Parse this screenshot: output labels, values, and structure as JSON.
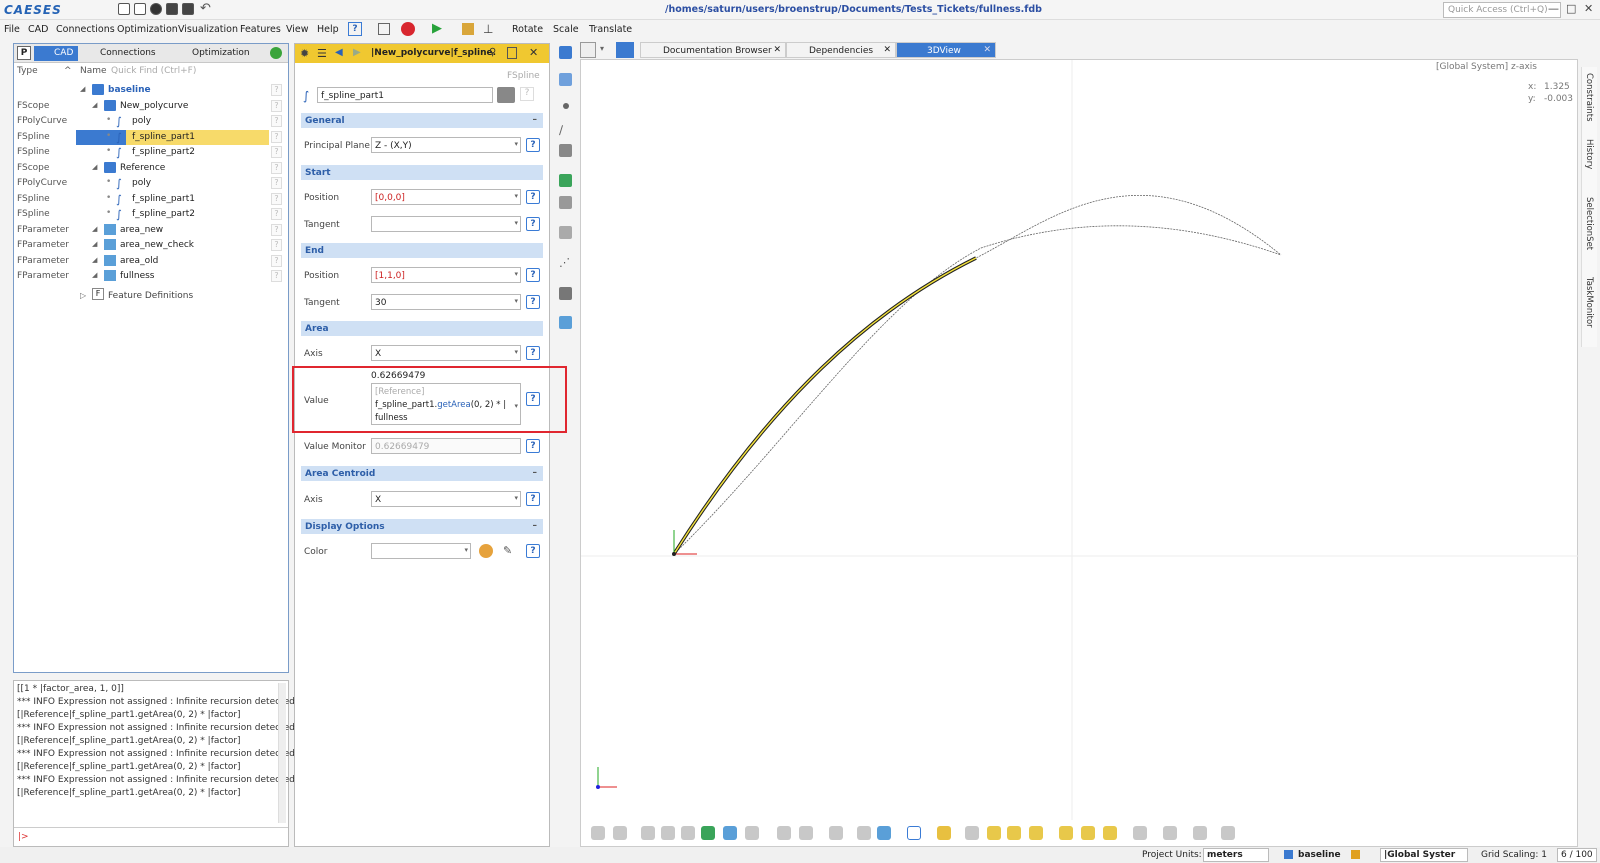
{
  "app": {
    "logo": "CAESES",
    "path": "/homes/saturn/users/broenstrup/Documents/Tests_Tickets/fullness.fdb",
    "quick_access_placeholder": "Quick Access (Ctrl+Q)"
  },
  "menu": [
    "File",
    "CAD",
    "Connections",
    "Optimization",
    "Visualization",
    "Features",
    "View",
    "Help"
  ],
  "menu_actions": {
    "rotate": "Rotate",
    "scale": "Scale",
    "translate": "Translate"
  },
  "left_panel": {
    "tabs": {
      "p": "P",
      "cad": "CAD",
      "connections": "Connections",
      "optimization": "Optimization"
    },
    "header": {
      "type": "Type",
      "name": "Name",
      "quick_find": "Quick Find (Ctrl+F)"
    },
    "rows": [
      {
        "type": "",
        "name": "baseline",
        "level": 0,
        "icon": "folder-icon"
      },
      {
        "type": "FScope",
        "name": "New_polycurve",
        "level": 1,
        "icon": "folder-icon"
      },
      {
        "type": "FPolyCurve",
        "name": "poly",
        "level": 2,
        "icon": "curve-icon"
      },
      {
        "type": "FSpline",
        "name": "f_spline_part1",
        "level": 2,
        "icon": "curve-icon",
        "selected": true
      },
      {
        "type": "FSpline",
        "name": "f_spline_part2",
        "level": 2,
        "icon": "curve-icon"
      },
      {
        "type": "FScope",
        "name": "Reference",
        "level": 1,
        "icon": "folder-icon"
      },
      {
        "type": "FPolyCurve",
        "name": "poly",
        "level": 2,
        "icon": "curve-icon"
      },
      {
        "type": "FSpline",
        "name": "f_spline_part1",
        "level": 2,
        "icon": "curve-icon"
      },
      {
        "type": "FSpline",
        "name": "f_spline_part2",
        "level": 2,
        "icon": "curve-icon"
      },
      {
        "type": "FParameter",
        "name": "area_new",
        "level": 1,
        "icon": "parameter-icon"
      },
      {
        "type": "FParameter",
        "name": "area_new_check",
        "level": 1,
        "icon": "parameter-icon"
      },
      {
        "type": "FParameter",
        "name": "area_old",
        "level": 1,
        "icon": "parameter-icon"
      },
      {
        "type": "FParameter",
        "name": "fullness",
        "level": 1,
        "icon": "parameter-icon"
      }
    ],
    "feature_definitions": "Feature Definitions",
    "help_mark": "?"
  },
  "console": {
    "lines": [
      "[[1 * |factor_area, 1, 0]]",
      "*** INFO Expression not assigned : Infinite recursion detected",
      "[|Reference|f_spline_part1.getArea(0, 2) * |factor]",
      "*** INFO Expression not assigned : Infinite recursion detected",
      "[|Reference|f_spline_part1.getArea(0, 2) * |factor]",
      "*** INFO Expression not assigned : Infinite recursion detected",
      "[|Reference|f_spline_part1.getArea(0, 2) * |factor]",
      "*** INFO Expression not assigned : Infinite recursion detected",
      "[|Reference|f_spline_part1.getArea(0, 2) * |factor]"
    ],
    "prompt": "|>"
  },
  "editor": {
    "title": "|New_polycurve|f_spline.",
    "type_label": "FSpline",
    "object_name": "f_spline_part1",
    "sections": {
      "general": "General",
      "start": "Start",
      "end": "End",
      "area": "Area",
      "area_centroid": "Area Centroid",
      "display": "Display Options"
    },
    "labels": {
      "principal_plane": "Principal Plane",
      "position": "Position",
      "tangent": "Tangent",
      "axis": "Axis",
      "value": "Value",
      "value_monitor": "Value Monitor",
      "color": "Color"
    },
    "values": {
      "principal_plane": "Z - (X,Y)",
      "start_position": "[0,0,0]",
      "start_tangent": "",
      "end_position": "[1,1,0]",
      "end_tangent": "30",
      "area_axis": "X",
      "area_value_result": "0.62669479",
      "area_value_hint": "[Reference]",
      "area_value_expr_obj": "f_spline_part1.",
      "area_value_expr_fn": "getArea",
      "area_value_expr_args": "(0, 2) * |",
      "area_value_expr_end": "fullness",
      "value_monitor": "0.62669479",
      "centroid_axis": "X"
    },
    "help_mark": "?",
    "collapse_mark": "–"
  },
  "view_tabs": [
    "Documentation Browser",
    "Dependencies",
    "3DView"
  ],
  "view": {
    "system": "[Global System] z-axis",
    "x_label": "x:",
    "x_value": "1.325",
    "y_label": "y:",
    "y_value": "-0.003"
  },
  "right_strip": [
    "Constraints",
    "History",
    "SelectionSet",
    "TaskMonitor"
  ],
  "status": {
    "project_units_label": "Project Units:",
    "project_units": "meters",
    "scope": "baseline",
    "system": "|Global Syster",
    "grid_scaling": "Grid Scaling: 1",
    "page": "6 / 100"
  },
  "colors": {
    "accent": "#3b7ad0",
    "selected": "#f7da6a",
    "editor_bar": "#f0c830",
    "highlight_box": "#e0262f"
  }
}
